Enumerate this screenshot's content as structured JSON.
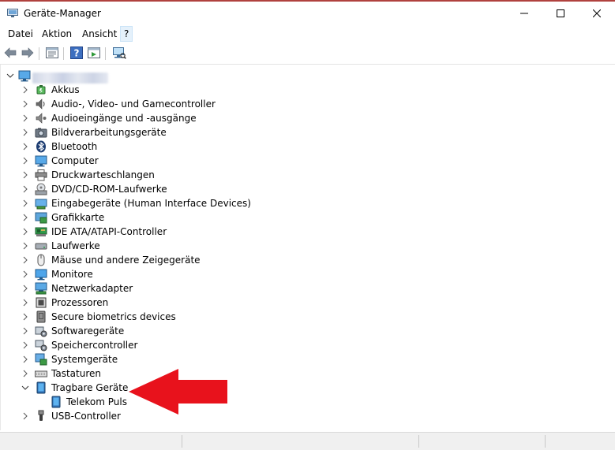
{
  "window": {
    "title": "Geräte-Manager"
  },
  "menu": [
    "Datei",
    "Aktion",
    "Ansicht",
    "?"
  ],
  "toolbar": [
    "back-icon",
    "forward-icon",
    "properties-icon",
    "help-icon",
    "update-driver-icon",
    "scan-hardware-icon"
  ],
  "tree": {
    "root": {
      "label": "",
      "expanded": true
    },
    "categories": [
      {
        "label": "Akkus",
        "icon": "battery-icon",
        "expanded": false
      },
      {
        "label": "Audio-, Video- und Gamecontroller",
        "icon": "speaker-icon",
        "expanded": false
      },
      {
        "label": "Audioeingänge und -ausgänge",
        "icon": "audio-io-icon",
        "expanded": false
      },
      {
        "label": "Bildverarbeitungsgeräte",
        "icon": "camera-icon",
        "expanded": false
      },
      {
        "label": "Bluetooth",
        "icon": "bluetooth-icon",
        "expanded": false
      },
      {
        "label": "Computer",
        "icon": "computer-icon",
        "expanded": false
      },
      {
        "label": "Druckwarteschlangen",
        "icon": "printer-icon",
        "expanded": false
      },
      {
        "label": "DVD/CD-ROM-Laufwerke",
        "icon": "dvd-drive-icon",
        "expanded": false
      },
      {
        "label": "Eingabegeräte (Human Interface Devices)",
        "icon": "hid-icon",
        "expanded": false
      },
      {
        "label": "Grafikkarte",
        "icon": "display-adapter-icon",
        "expanded": false
      },
      {
        "label": "IDE ATA/ATAPI-Controller",
        "icon": "ide-controller-icon",
        "expanded": false
      },
      {
        "label": "Laufwerke",
        "icon": "disk-drive-icon",
        "expanded": false
      },
      {
        "label": "Mäuse und andere Zeigegeräte",
        "icon": "mouse-icon",
        "expanded": false
      },
      {
        "label": "Monitore",
        "icon": "monitor-icon",
        "expanded": false
      },
      {
        "label": "Netzwerkadapter",
        "icon": "network-adapter-icon",
        "expanded": false
      },
      {
        "label": "Prozessoren",
        "icon": "processor-icon",
        "expanded": false
      },
      {
        "label": "Secure biometrics devices",
        "icon": "biometric-icon",
        "expanded": false
      },
      {
        "label": "Softwaregeräte",
        "icon": "software-device-icon",
        "expanded": false
      },
      {
        "label": "Speichercontroller",
        "icon": "storage-controller-icon",
        "expanded": false
      },
      {
        "label": "Systemgeräte",
        "icon": "system-device-icon",
        "expanded": false
      },
      {
        "label": "Tastaturen",
        "icon": "keyboard-icon",
        "expanded": false
      },
      {
        "label": "Tragbare Geräte",
        "icon": "portable-device-icon",
        "expanded": true
      },
      {
        "label": "Telekom Puls",
        "icon": "portable-device-icon",
        "child": true
      },
      {
        "label": "USB-Controller",
        "icon": "usb-icon",
        "expanded": false
      }
    ]
  },
  "colors": {
    "annotation_arrow": "#e8121c",
    "accent": "#1e7bd6",
    "titlebar_top_line": "#b0413e"
  }
}
